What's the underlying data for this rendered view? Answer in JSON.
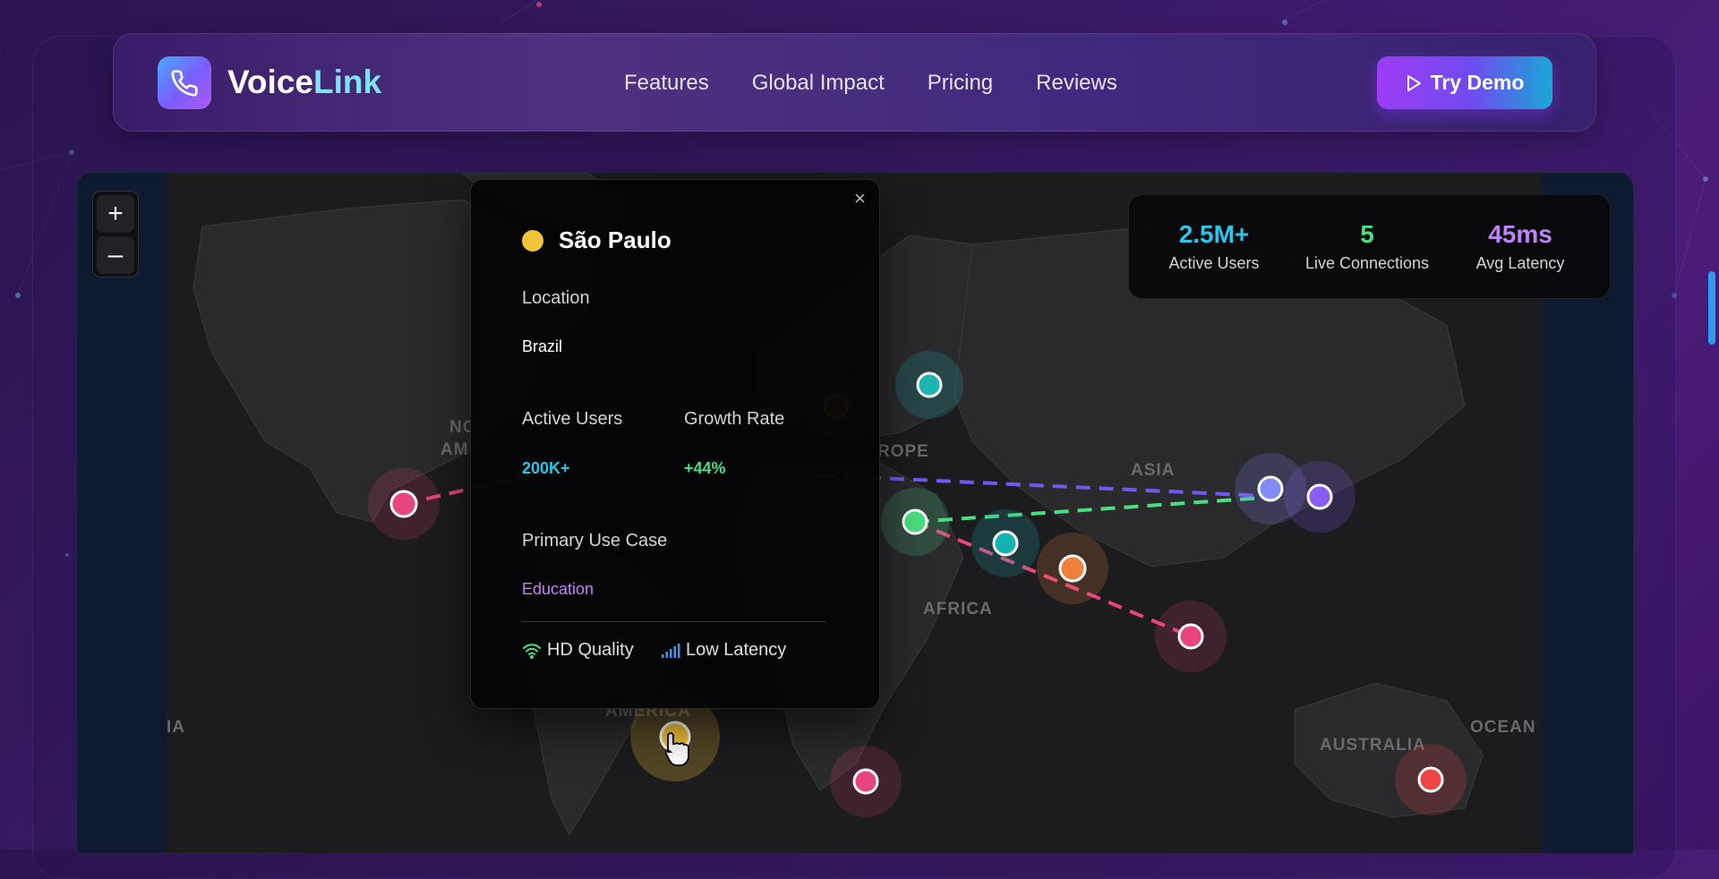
{
  "brand": {
    "name_part1": "Voice",
    "name_part2": "Link",
    "logo_icon": "phone-icon"
  },
  "nav": {
    "items": [
      "Features",
      "Global Impact",
      "Pricing",
      "Reviews"
    ]
  },
  "cta": {
    "label": "Try Demo",
    "icon": "play-icon"
  },
  "zoom": {
    "in_label": "+",
    "out_label": "–"
  },
  "stats": [
    {
      "value": "2.5M+",
      "label": "Active Users",
      "color": "#2ec4e8"
    },
    {
      "value": "5",
      "label": "Live Connections",
      "color": "#4ade80"
    },
    {
      "value": "45ms",
      "label": "Avg Latency",
      "color": "#c084fc"
    }
  ],
  "map_labels": {
    "north_america_1": "NO",
    "north_america_2": "AM",
    "europe": "ROPE",
    "asia": "ASIA",
    "africa": "AFRICA",
    "south_america": "AMERICA",
    "australia": "AUSTRALIA",
    "ocean": "OCEAN",
    "left_ocean": "IA"
  },
  "popup": {
    "close_label": "×",
    "city": "São Paulo",
    "location_label": "Location",
    "location_value": "Brazil",
    "users_label": "Active Users",
    "users_value": "200K+",
    "growth_label": "Growth Rate",
    "growth_value": "+44%",
    "usecase_label": "Primary Use Case",
    "usecase_value": "Education",
    "feature_1": "HD Quality",
    "feature_2": "Low Latency",
    "dot_color": "#f2c437"
  },
  "colors": {
    "cyan": "#2ec4e8",
    "green": "#4ade80",
    "purple": "#c084fc",
    "pink": "#e8457f",
    "teal": "#1fb5b0",
    "orange": "#f07f3c",
    "yellow": "#f2c437"
  }
}
